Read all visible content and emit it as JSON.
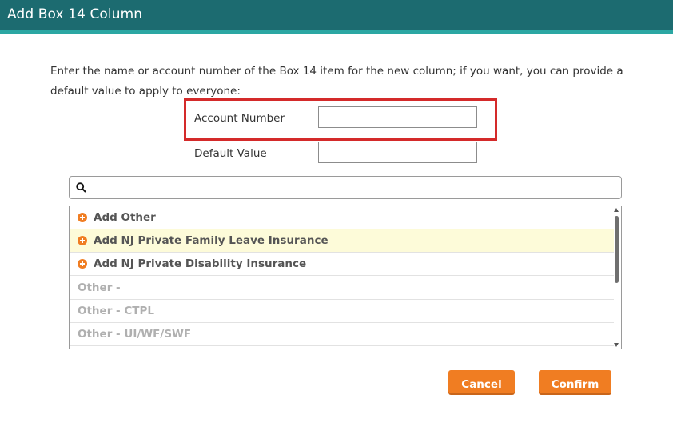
{
  "dialog": {
    "title": "Add Box 14 Column"
  },
  "instructions": "Enter the name or account number of the Box 14 item for the new column; if you want, you can provide a default value to apply to everyone:",
  "form": {
    "account_number_label": "Account Number",
    "account_number_value": "",
    "default_value_label": "Default Value",
    "default_value_value": ""
  },
  "search": {
    "value": ""
  },
  "list": {
    "items": [
      {
        "label": "Add Other",
        "type": "add"
      },
      {
        "label": "Add NJ Private Family Leave Insurance",
        "type": "add",
        "highlighted": true
      },
      {
        "label": "Add NJ Private Disability Insurance",
        "type": "add"
      },
      {
        "label": "Other -",
        "type": "existing"
      },
      {
        "label": "Other - CTPL",
        "type": "existing"
      },
      {
        "label": "Other - UI/WF/SWF",
        "type": "existing"
      }
    ]
  },
  "buttons": {
    "cancel": "Cancel",
    "confirm": "Confirm"
  },
  "colors": {
    "title_bar": "#1c6b70",
    "title_bar_accent": "#2ba7a3",
    "button": "#f07d22",
    "highlight_border": "#d42a2a",
    "row_highlight": "#fdfbd9"
  },
  "icons": {
    "search": "search-icon",
    "add": "plus-circle-icon"
  }
}
